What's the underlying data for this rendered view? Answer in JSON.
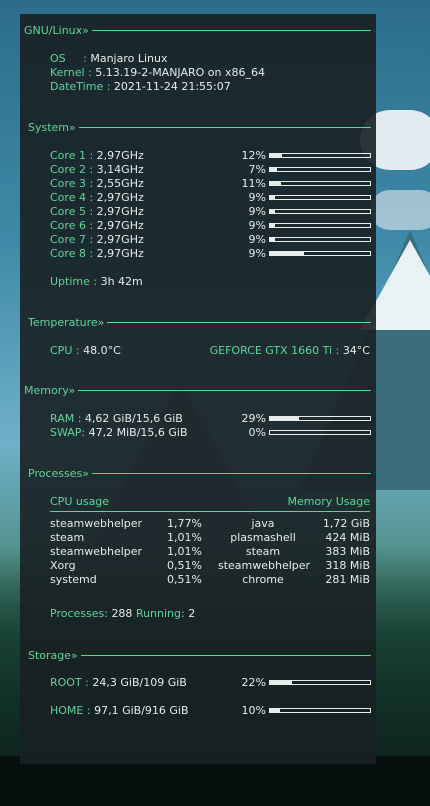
{
  "sections": {
    "gnu_linux": "GNU/Linux»",
    "system": "System»",
    "temperature": "Temperature»",
    "memory": "Memory»",
    "processes": "Processes»",
    "storage": "Storage»"
  },
  "os": {
    "os_label": "OS     :",
    "os_value": "Manjaro Linux",
    "kernel_label": "Kernel :",
    "kernel_value": "5.13.19-2-MANJARO on x86_64",
    "datetime_label": "DateTime :",
    "datetime_value": "2021-11-24 21:55:07"
  },
  "cores": [
    {
      "label": "Core 1 :",
      "freq": "2,97GHz",
      "pct": "12%",
      "load": 0.12
    },
    {
      "label": "Core 2 :",
      "freq": "3,14GHz",
      "pct": "7%",
      "load": 0.07
    },
    {
      "label": "Core 3 :",
      "freq": "2,55GHz",
      "pct": "11%",
      "load": 0.11
    },
    {
      "label": "Core 4 :",
      "freq": "2,97GHz",
      "pct": "9%",
      "load": 0.05
    },
    {
      "label": "Core 5 :",
      "freq": "2,97GHz",
      "pct": "9%",
      "load": 0.05
    },
    {
      "label": "Core 6 :",
      "freq": "2,97GHz",
      "pct": "9%",
      "load": 0.05
    },
    {
      "label": "Core 7 :",
      "freq": "2,97GHz",
      "pct": "9%",
      "load": 0.05
    },
    {
      "label": "Core 8 :",
      "freq": "2,97GHz",
      "pct": "9%",
      "load": 0.34
    }
  ],
  "uptime": {
    "label": "Uptime :",
    "value": "3h 42m"
  },
  "temperature": {
    "cpu_label": "CPU :",
    "cpu_value": "48.0°C",
    "gpu_label": "GEFORCE GTX 1660 Ti :",
    "gpu_value": "34°C"
  },
  "memory": {
    "ram_label": "RAM :",
    "ram_value": "4,62 GiB/15,6 GiB",
    "ram_pct": "29%",
    "ram_load": 0.29,
    "swap_label": "SWAP:",
    "swap_value": "47,2 MiB/15,6 GiB",
    "swap_pct": "0%",
    "swap_load": 0.0
  },
  "processes": {
    "cpu_header": "CPU usage",
    "mem_header": "Memory Usage",
    "cpu": [
      {
        "name": "steamwebhelper",
        "value": "1,77%"
      },
      {
        "name": "steam",
        "value": "1,01%"
      },
      {
        "name": "steamwebhelper",
        "value": "1,01%"
      },
      {
        "name": "Xorg",
        "value": "0,51%"
      },
      {
        "name": "systemd",
        "value": "0,51%"
      }
    ],
    "mem": [
      {
        "name": "java",
        "value": "1,72 GiB"
      },
      {
        "name": "plasmashell",
        "value": "424 MiB"
      },
      {
        "name": "steam",
        "value": "383 MiB"
      },
      {
        "name": "steamwebhelper",
        "value": "318 MiB"
      },
      {
        "name": "chrome",
        "value": "281 MiB"
      }
    ],
    "count_label": "Processes:",
    "count_value": "288",
    "running_label": "Running:",
    "running_value": "2"
  },
  "storage": {
    "root_label": "ROOT :",
    "root_value": "24,3 GiB/109 GiB",
    "root_pct": "22%",
    "root_load": 0.22,
    "home_label": "HOME :",
    "home_value": "97,1 GiB/916 GiB",
    "home_pct": "10%",
    "home_load": 0.1
  }
}
